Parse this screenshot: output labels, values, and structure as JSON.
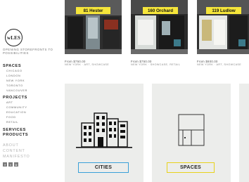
{
  "brand": {
    "logo_text": "wLES",
    "tagline": "OPENING STOREFRONTS TO POSSIBILITIES"
  },
  "nav": {
    "spaces": {
      "label": "SPACES",
      "items": [
        "CHICAGO",
        "LONDON",
        "NEW YORK",
        "TORONTO",
        "VANCOUVER"
      ]
    },
    "projects": {
      "label": "PROJECTS",
      "items": [
        "ART",
        "COMMUNITY",
        "EDUCATION",
        "FOOD",
        "RETAIL"
      ]
    },
    "services_label": "SERVICES",
    "products_label": "PRODUCTS",
    "secondary": [
      "ABOUT",
      "CONTENT",
      "MANIFESTO"
    ]
  },
  "social_icons": [
    "facebook-icon",
    "twitter-icon",
    "instagram-icon"
  ],
  "listings": [
    {
      "name": "81 Hester",
      "price": "From $750.00",
      "meta": "NEW YORK · ART, SHOWCASE"
    },
    {
      "name": "160 Orchard",
      "price": "From $750.00",
      "meta": "NEW YORK · SHOWCASE, RETAIL"
    },
    {
      "name": "119 Ludlow",
      "price": "From $800.00",
      "meta": "NEW YORK · ART, SHOWCASE"
    }
  ],
  "categories": [
    {
      "label": "CITIES",
      "accent": "#3aa0d8"
    },
    {
      "label": "SPACES",
      "accent": "#e7d21c"
    }
  ],
  "colors": {
    "pill": "#f5e53a",
    "tile_bg": "#ecedeb"
  }
}
